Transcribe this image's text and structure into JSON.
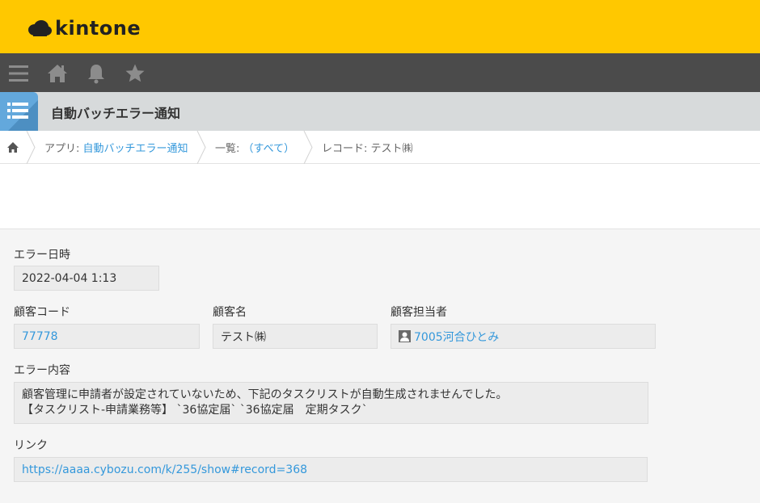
{
  "brand": {
    "logo_text": "kintone"
  },
  "app": {
    "title": "自動バッチエラー通知"
  },
  "breadcrumb": {
    "app_prefix": "アプリ:",
    "app_link": "自動バッチエラー通知",
    "list_prefix": "一覧:",
    "list_link": "（すべて）",
    "record_label": "レコード: テスト㈱"
  },
  "fields": {
    "error_datetime": {
      "label": "エラー日時",
      "value": "2022-04-04 1:13"
    },
    "customer_code": {
      "label": "顧客コード",
      "value": "77778"
    },
    "customer_name": {
      "label": "顧客名",
      "value": "テスト㈱"
    },
    "customer_owner": {
      "label": "顧客担当者",
      "value": "7005河合ひとみ"
    },
    "error_content": {
      "label": "エラー内容",
      "line1": "顧客管理に申請者が設定されていないため、下記のタスクリストが自動生成されませんでした。",
      "line2": "【タスクリスト-申請業務等】 `36協定届` `36協定届　定期タスク`"
    },
    "link": {
      "label": "リンク",
      "value": "https://aaaa.cybozu.com/k/255/show#record=368"
    }
  },
  "colors": {
    "brand_yellow": "#ffc800",
    "nav_dark": "#4b4b4b",
    "link_blue": "#3498db"
  }
}
